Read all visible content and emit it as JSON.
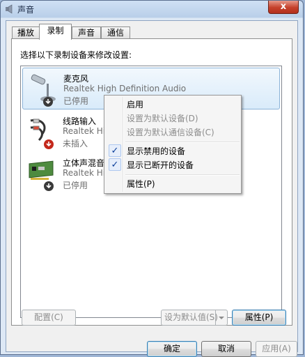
{
  "window": {
    "title": "声音",
    "close_label": "x"
  },
  "tabs": [
    {
      "label": "播放"
    },
    {
      "label": "录制"
    },
    {
      "label": "声音"
    },
    {
      "label": "通信"
    }
  ],
  "instruction": "选择以下录制设备来修改设置:",
  "devices": [
    {
      "name": "麦克风",
      "driver": "Realtek High Definition Audio",
      "status": "已停用"
    },
    {
      "name": "线路输入",
      "driver": "Realtek Hig",
      "status": "未插入"
    },
    {
      "name": "立体声混音",
      "driver": "Realtek Hig",
      "status": "已停用"
    }
  ],
  "context_menu": {
    "items": [
      {
        "label": "启用",
        "enabled": true,
        "checked": false
      },
      {
        "label": "设置为默认设备(D)",
        "enabled": false,
        "checked": false
      },
      {
        "label": "设置为默认通信设备(C)",
        "enabled": false,
        "checked": false
      },
      {
        "label": "显示禁用的设备",
        "enabled": true,
        "checked": true
      },
      {
        "label": "显示已断开的设备",
        "enabled": true,
        "checked": true
      },
      {
        "label": "属性(P)",
        "enabled": true,
        "checked": false
      }
    ],
    "check_glyph": "✓"
  },
  "buttons": {
    "configure": "配置(C)",
    "set_default": "设为默认值(S)",
    "properties": "属性(P)",
    "ok": "确定",
    "cancel": "取消",
    "apply": "应用(A)"
  },
  "colors": {
    "selection_border": "#8bb3d8",
    "check_color": "#0c3f9a",
    "close_button": "#c5402b"
  }
}
